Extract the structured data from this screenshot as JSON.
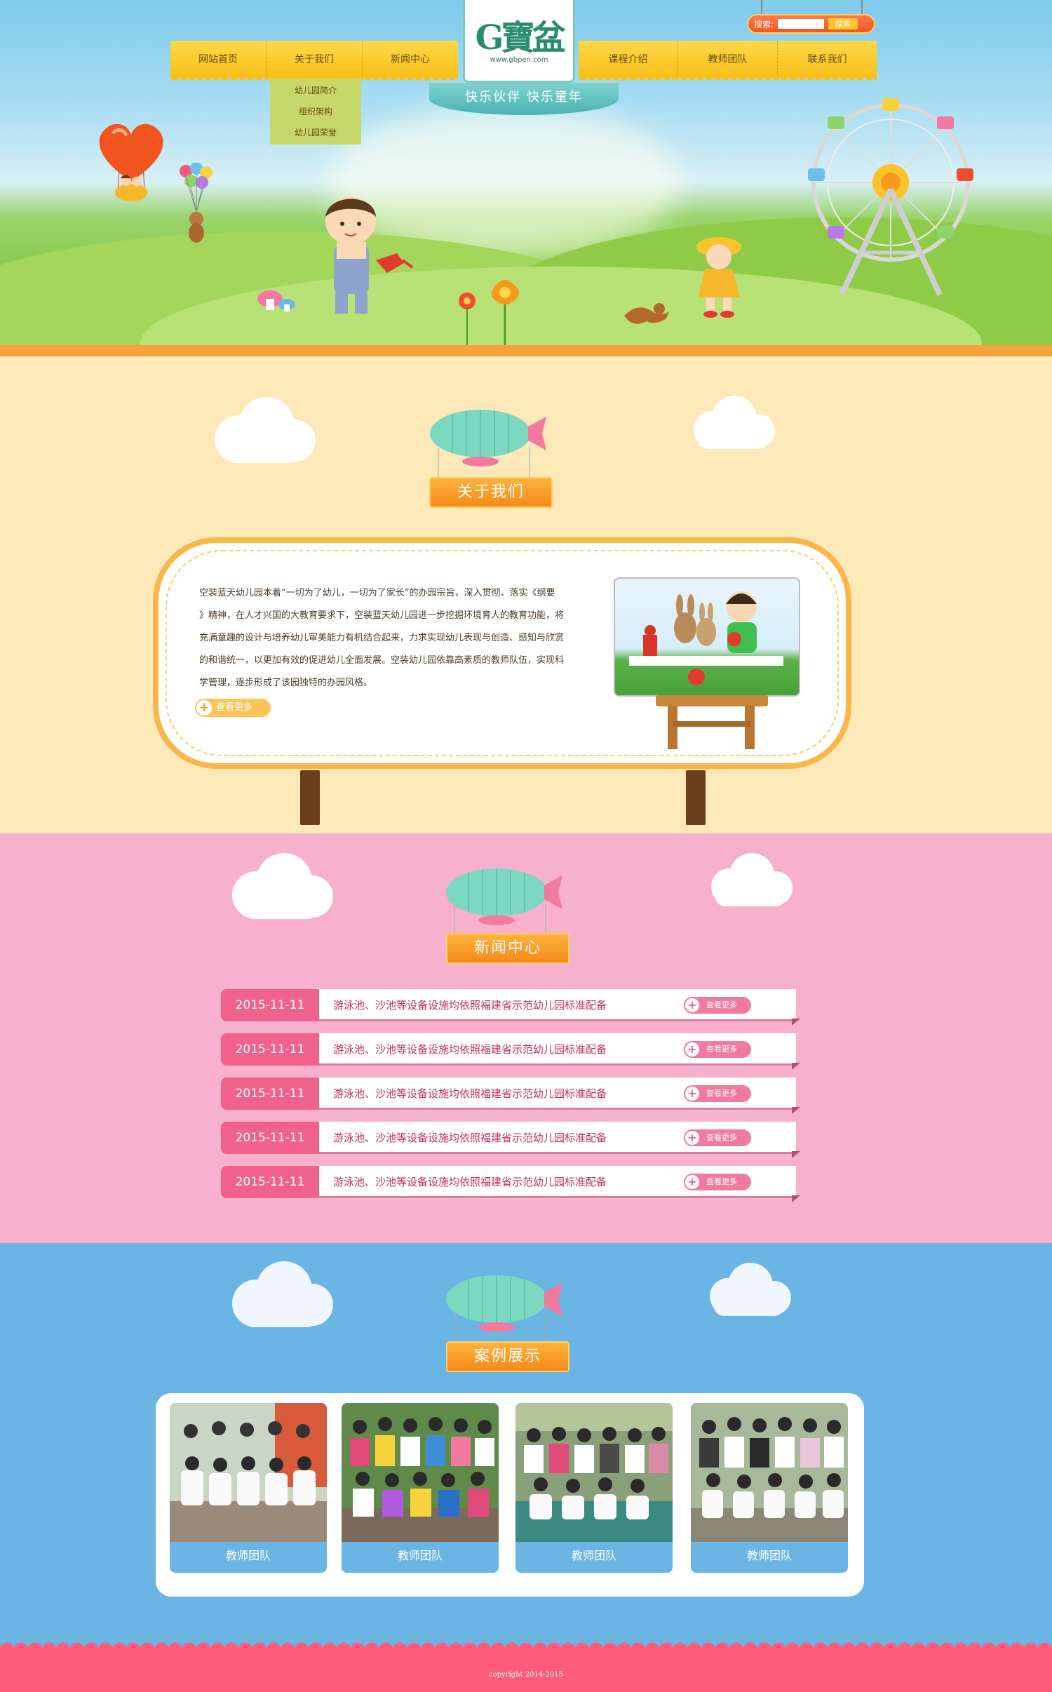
{
  "nav": {
    "left": [
      "网站首页",
      "关于我们",
      "新闻中心"
    ],
    "right": [
      "课程介绍",
      "教师团队",
      "联系我们"
    ]
  },
  "submenu": [
    "幼儿园简介",
    "组织架构",
    "幼儿园荣誉"
  ],
  "logo": {
    "mark": "G寶盆",
    "url": "www.gbpen.com"
  },
  "slogan": "快乐伙伴  快乐童年",
  "search": {
    "label": "搜索:",
    "button": "搜索",
    "value": ""
  },
  "about": {
    "heading": "关于我们",
    "lines": [
      "空装蓝天幼儿园本着“一切为了幼儿，一切为了家长”的办园宗旨，深入贯彻、落实《纲要",
      "》精神，在人才兴国的大教育要求下，空装蓝天幼儿园进一步挖掘环境育人的教育功能，将",
      "充满童趣的设计与培养幼儿审美能力有机结合起来，力求实现幼儿表现与创造、感知与欣赏",
      "的和谐统一，以更加有效的促进幼儿全面发展。空装幼儿园依靠高素质的教师队伍，实现科",
      "学管理，逐步形成了该园独特的办园风格。"
    ],
    "more": "查看更多"
  },
  "news": {
    "heading": "新闻中心",
    "more": "查看更多",
    "items": [
      {
        "date": "2015-11-11",
        "title": "游泳池、沙池等设备设施均依照福建省示范幼儿园标准配备"
      },
      {
        "date": "2015-11-11",
        "title": "游泳池、沙池等设备设施均依照福建省示范幼儿园标准配备"
      },
      {
        "date": "2015-11-11",
        "title": "游泳池、沙池等设备设施均依照福建省示范幼儿园标准配备"
      },
      {
        "date": "2015-11-11",
        "title": "游泳池、沙池等设备设施均依照福建省示范幼儿园标准配备"
      },
      {
        "date": "2015-11-11",
        "title": "游泳池、沙池等设备设施均依照福建省示范幼儿园标准配备"
      }
    ]
  },
  "cases": {
    "heading": "案例展示",
    "items": [
      "教师团队",
      "教师团队",
      "教师团队",
      "教师团队"
    ]
  },
  "footer": {
    "copyright": "copyright 2014-2015"
  },
  "colors": {
    "nav": "#f8bf17",
    "about_bg": "#fde9b8",
    "news_bg": "#f8b1cc",
    "cases_bg": "#6ab5e3",
    "footer_bg": "#ff5c7a",
    "heading": "#f48a1a"
  }
}
